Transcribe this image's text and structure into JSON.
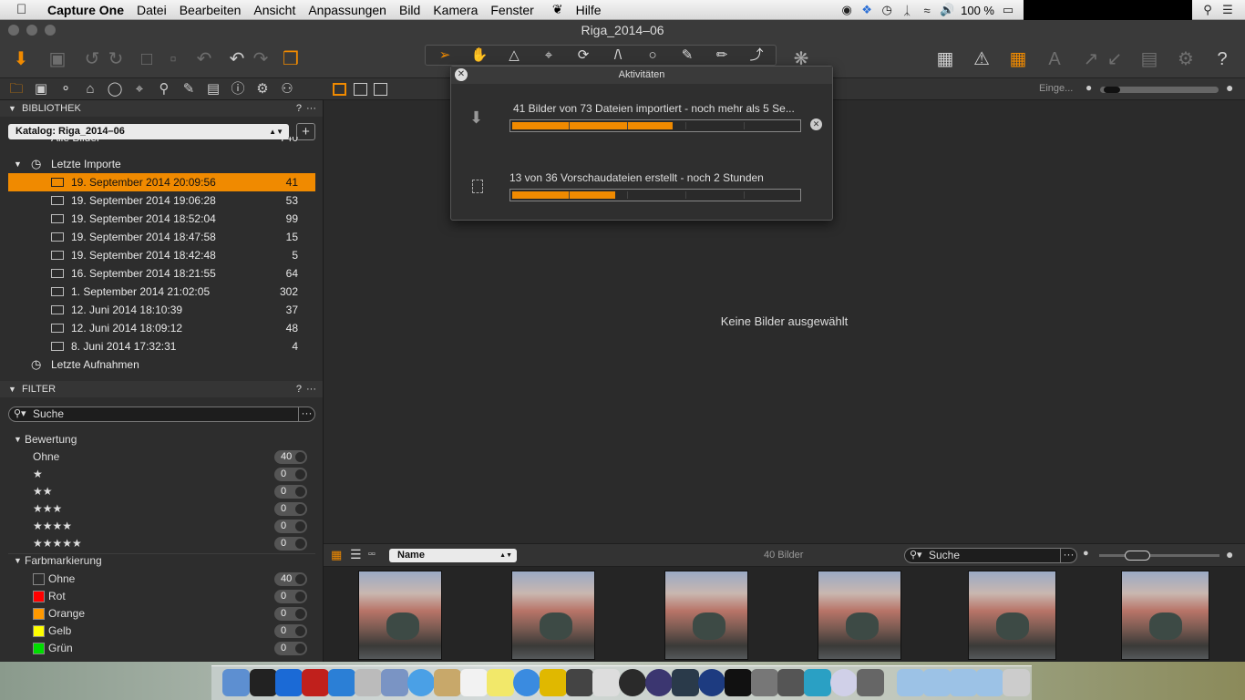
{
  "menubar": {
    "app": "Capture One",
    "items": [
      "Datei",
      "Bearbeiten",
      "Ansicht",
      "Anpassungen",
      "Bild",
      "Kamera",
      "Fenster",
      "Hilfe"
    ],
    "battery": "100 %"
  },
  "window": {
    "title": "Riga_2014–06"
  },
  "bibliothek": {
    "header": "BIBLIOTHEK",
    "help": "?",
    "dots": "···",
    "catalog": "Katalog: Riga_2014–06",
    "add": "+",
    "all_images": "Alle Bilder",
    "all_images_count": "740",
    "recent_imports": "Letzte Importe",
    "imports": [
      {
        "label": "19. September 2014 20:09:56",
        "count": "41"
      },
      {
        "label": "19. September 2014 19:06:28",
        "count": "53"
      },
      {
        "label": "19. September 2014 18:52:04",
        "count": "99"
      },
      {
        "label": "19. September 2014 18:47:58",
        "count": "15"
      },
      {
        "label": "19. September 2014 18:42:48",
        "count": "5"
      },
      {
        "label": "16. September 2014 18:21:55",
        "count": "64"
      },
      {
        "label": "1. September 2014 21:02:05",
        "count": "302"
      },
      {
        "label": "12. Juni 2014 18:10:39",
        "count": "37"
      },
      {
        "label": "12. Juni 2014 18:09:12",
        "count": "48"
      },
      {
        "label": "8. Juni 2014 17:32:31",
        "count": "4"
      }
    ],
    "recent_captures": "Letzte Aufnahmen"
  },
  "filter": {
    "header": "FILTER",
    "help": "?",
    "dots": "···",
    "search_placeholder": "Suche",
    "search_dots": "···",
    "rating_header": "Bewertung",
    "ratings": [
      {
        "label": "Ohne",
        "count": "40"
      },
      {
        "label": "★",
        "count": "0"
      },
      {
        "label": "★★",
        "count": "0"
      },
      {
        "label": "★★★",
        "count": "0"
      },
      {
        "label": "★★★★",
        "count": "0"
      },
      {
        "label": "★★★★★",
        "count": "0"
      }
    ],
    "color_header": "Farbmarkierung",
    "colors": [
      {
        "label": "Ohne",
        "count": "40",
        "color": "#2d2d2d"
      },
      {
        "label": "Rot",
        "count": "0",
        "color": "#ff0000"
      },
      {
        "label": "Orange",
        "count": "0",
        "color": "#ff9900"
      },
      {
        "label": "Gelb",
        "count": "0",
        "color": "#ffff00"
      },
      {
        "label": "Grün",
        "count": "0",
        "color": "#00dd00"
      }
    ]
  },
  "viewer": {
    "no_selection": "Keine Bilder ausgewählt",
    "zoom_label": "Einge..."
  },
  "activity": {
    "title": "Aktivitäten",
    "tasks": [
      {
        "text": "41 Bilder von 73 Dateien importiert - noch mehr als 5 Se...",
        "progress": 0.56
      },
      {
        "text": "13 von 36 Vorschaudateien erstellt - noch 2 Stunden",
        "progress": 0.36
      }
    ]
  },
  "browser": {
    "sort": "Name",
    "count_label": "40 Bilder",
    "search_placeholder": "Suche",
    "search_dots": "···",
    "thumb_count": 6
  },
  "colors": {
    "accent": "#f08a00"
  }
}
